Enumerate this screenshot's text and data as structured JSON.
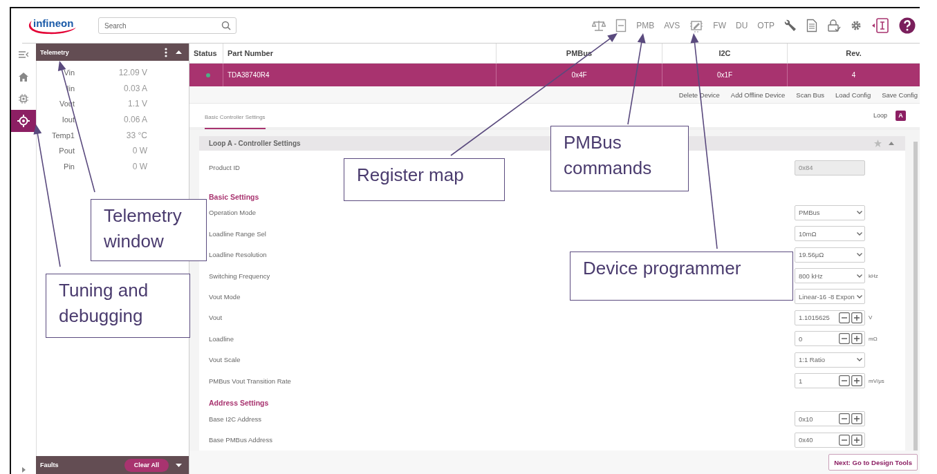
{
  "header": {
    "logo": "infineon",
    "search": {
      "placeholder": "Search"
    },
    "toolbar_labels": [
      "PMB",
      "AVS",
      "FW",
      "DU",
      "OTP"
    ]
  },
  "rail": [
    {
      "selected": false
    },
    {
      "selected": false
    },
    {
      "selected": false
    },
    {
      "selected": true
    }
  ],
  "telemetry": {
    "title": "Telemetry",
    "rows": [
      {
        "label": "Vin",
        "value": "12.09 V"
      },
      {
        "label": "Iin",
        "value": "0.03 A"
      },
      {
        "label": "Vout",
        "value": "1.1 V"
      },
      {
        "label": "Iout",
        "value": "0.06 A"
      },
      {
        "label": "Temp1",
        "value": "33 °C"
      },
      {
        "label": "Pout",
        "value": "0 W"
      },
      {
        "label": "Pin",
        "value": "0 W"
      }
    ]
  },
  "faults": {
    "title": "Faults",
    "button": "Clear All"
  },
  "table": {
    "columns": [
      "Status",
      "Part Number",
      "PMBus",
      "I2C",
      "Rev."
    ],
    "rows": [
      {
        "selected": true,
        "color": "#4fae86",
        "part_number": "TDA38740R4",
        "pmbus": "0x4F",
        "i2c": "0x1F",
        "rev": "4"
      }
    ]
  },
  "actions": [
    "Delete Device",
    "Add Offline Device",
    "Scan Bus",
    "Load Config",
    "Save Config"
  ],
  "tabs": [
    {
      "label": "Basic Controller Settings",
      "selected": true
    }
  ],
  "loop": {
    "label": "Loop",
    "value": "A"
  },
  "card": {
    "title": "Loop A - Controller Settings",
    "fields": [
      {
        "kind": "readonly",
        "label": "Product ID",
        "value": "0x84"
      },
      {
        "kind": "section",
        "label": "Basic Settings"
      },
      {
        "kind": "select",
        "label": "Operation Mode",
        "value": "PMBus"
      },
      {
        "kind": "select",
        "label": "Loadline Range Sel",
        "value": "10mΩ"
      },
      {
        "kind": "select",
        "label": "Loadline Resolution",
        "value": "19.56μΩ"
      },
      {
        "kind": "select",
        "label": "Switching Frequency",
        "value": "800 kHz",
        "unit": "kHz"
      },
      {
        "kind": "select",
        "label": "Vout Mode",
        "value": "Linear-16 -8 Expon"
      },
      {
        "kind": "number",
        "label": "Vout",
        "value": "1.1015625",
        "unit": "V"
      },
      {
        "kind": "number",
        "label": "Loadline",
        "value": "0",
        "unit": "mΩ"
      },
      {
        "kind": "select",
        "label": "Vout Scale",
        "value": "1:1 Ratio"
      },
      {
        "kind": "number",
        "label": "PMBus Vout Transition Rate",
        "value": "1",
        "unit": "mV/μs"
      },
      {
        "kind": "section",
        "label": "Address Settings"
      },
      {
        "kind": "number",
        "label": "Base I2C Address",
        "value": "0x10"
      },
      {
        "kind": "number",
        "label": "Base PMBus Address",
        "value": "0x40"
      }
    ]
  },
  "next_button": "Next: Go to Design Tools",
  "annotations": [
    {
      "text": "Telemetry window"
    },
    {
      "text": "Tuning and debugging"
    },
    {
      "text": "Register map"
    },
    {
      "text": "PMBus commands"
    },
    {
      "text": "Device programmer"
    }
  ]
}
